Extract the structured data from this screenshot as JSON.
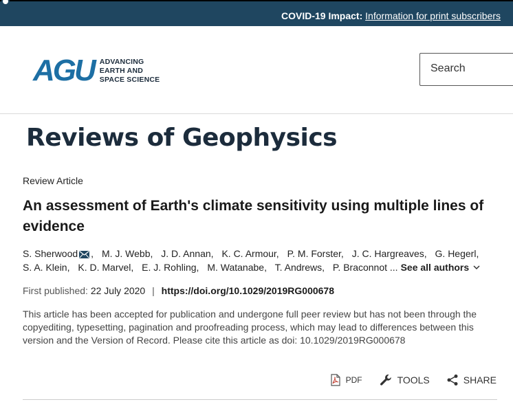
{
  "topbar": {
    "label": "COVID-19 Impact:",
    "link": "Information for print subscribers"
  },
  "header": {
    "logo": {
      "mark": "AGU",
      "line1": "ADVANCING",
      "line2": "EARTH AND",
      "line3": "SPACE SCIENCE"
    },
    "search": {
      "placeholder": "Search"
    }
  },
  "journal": {
    "title": "Reviews of Geophysics"
  },
  "article": {
    "type": "Review Article",
    "title": "An assessment of Earth's climate sensitivity using multiple lines of evidence",
    "authors": [
      "S. Sherwood",
      "M. J. Webb,",
      "J. D. Annan,",
      "K. C. Armour,",
      "P. M. Forster,",
      "J. C. Hargreaves,",
      "G. Hegerl,",
      "S. A. Klein,",
      "K. D. Marvel,",
      "E. J. Rohling,",
      "M. Watanabe,",
      "T. Andrews,",
      "P. Braconnot ..."
    ],
    "first_author_suffix": ",",
    "see_all": "See all authors",
    "first_published_label": "First published:",
    "first_published_date": "22 July 2020",
    "separator": "|",
    "doi": "https://doi.org/10.1029/2019RG000678",
    "notice": "This article has been accepted for publication and undergone full peer review but has not been through the copyediting, typesetting, pagination and proofreading process, which may lead to differences between this version and the Version of Record. Please cite this article as doi: 10.1029/2019RG000678"
  },
  "actions": {
    "pdf": "PDF",
    "tools": "TOOLS",
    "share": "SHARE"
  },
  "colors": {
    "topbar": "#1f4660",
    "logo_blue": "#1d6fa4",
    "text_dark": "#1c2c3c"
  }
}
